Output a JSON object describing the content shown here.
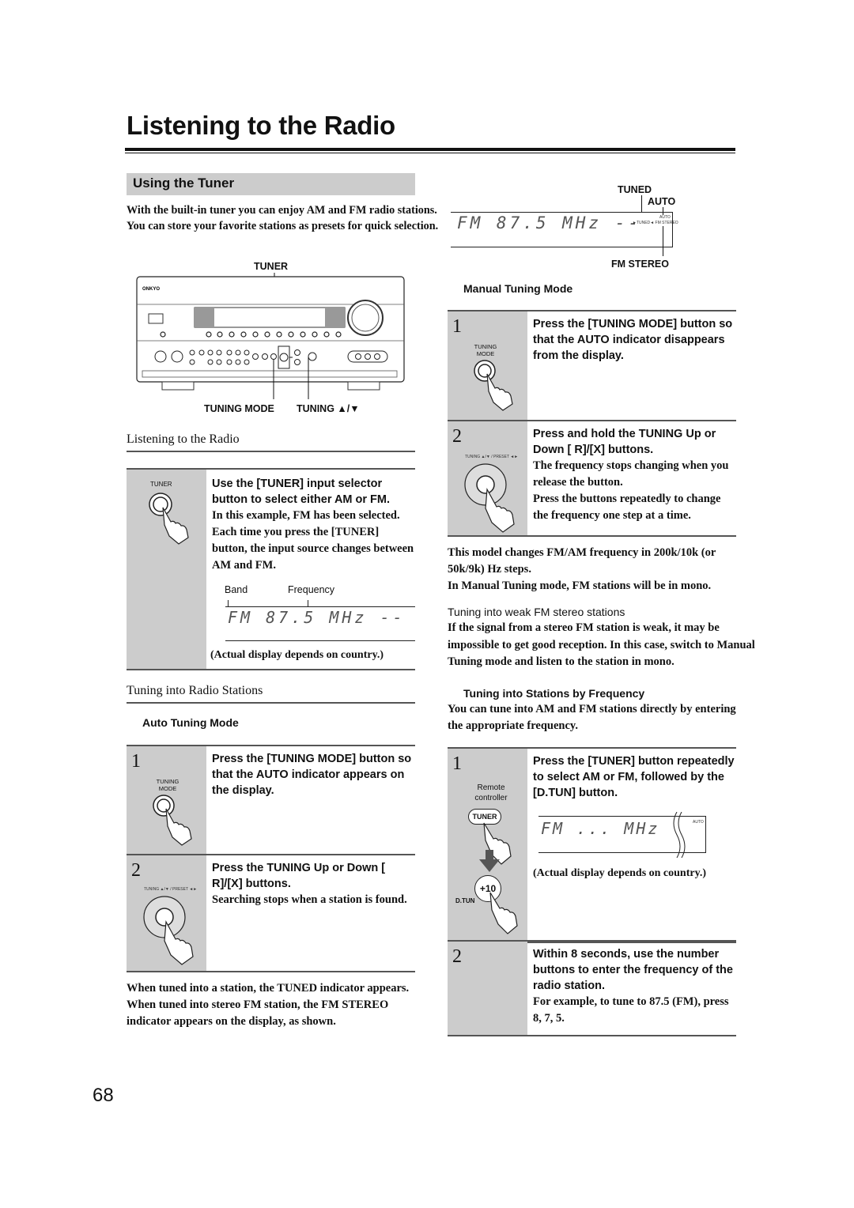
{
  "page": {
    "title": "Listening to the Radio",
    "page_number": "68"
  },
  "section": {
    "title": "Using the Tuner",
    "intro": "With the built-in tuner you can enjoy AM and FM radio stations. You can store your favorite stations as presets for quick selection."
  },
  "receiver_diagram": {
    "brand": "ONKYO",
    "callout_tuner": "TUNER",
    "callout_tuning_mode": "TUNING MODE",
    "callout_tuning": "TUNING ▲/▼"
  },
  "listening": {
    "heading": "Listening to the Radio",
    "step": {
      "icon_label": "TUNER",
      "main": "Use the [TUNER] input selector button to select either AM or FM.",
      "sub1": "In this example, FM has been selected.",
      "sub2": "Each time you press the [TUNER] button, the input source changes between AM and FM.",
      "band_label": "Band",
      "frequency_label": "Frequency",
      "display": "FM  87.5  MHz  --",
      "note": "(Actual display depends on country.)"
    }
  },
  "tuning_stations": {
    "heading": "Tuning into Radio Stations",
    "auto_mode": {
      "heading": "Auto Tuning Mode",
      "steps": [
        {
          "number": "1",
          "icon_label": "TUNING MODE",
          "main": "Press the [TUNING MODE] button so that the AUTO indicator appears on the display."
        },
        {
          "number": "2",
          "icon_label": "TUNING ▲/▼ / PRESET ◄►",
          "main": "Press the TUNING Up or Down [ R]/[X] buttons.",
          "sub": "Searching stops when a station is found."
        }
      ]
    },
    "tuned_note": "When tuned into a station, the TUNED indicator appears. When tuned into stereo FM station, the FM STEREO indicator appears on the display, as shown."
  },
  "indicator_display": {
    "callout_tuned": "TUNED",
    "callout_auto": "AUTO",
    "callout_fm_stereo": "FM STEREO",
    "display": "FM  87.5  MHz  --",
    "small_auto": "AUTO",
    "small_line": "►TUNED◄ FM STEREO"
  },
  "manual_mode": {
    "heading": "Manual Tuning Mode",
    "steps": [
      {
        "number": "1",
        "icon_label": "TUNING MODE",
        "main": "Press the [TUNING MODE] button so that the AUTO indicator disappears from the display."
      },
      {
        "number": "2",
        "icon_label": "TUNING ▲/▼ / PRESET ◄►",
        "main": "Press and hold the TUNING Up or Down [ R]/[X] buttons.",
        "sub1": "The frequency stops changing when you release the button.",
        "sub2": "Press the buttons repeatedly to change the frequency one step at a time."
      }
    ],
    "note1": "This model changes FM/AM frequency in 200k/10k (or 50k/9k) Hz steps.",
    "note2": "In Manual Tuning mode, FM stations will be in mono."
  },
  "weak_stereo": {
    "heading": "Tuning into weak FM stereo stations",
    "text": "If the signal from a stereo FM station is weak, it may be impossible to get good reception. In this case, switch to Manual Tuning mode and listen to the station in mono."
  },
  "by_frequency": {
    "heading": "Tuning into Stations by Frequency",
    "intro": "You can tune into AM and FM stations directly by entering the appropriate frequency.",
    "steps": [
      {
        "number": "1",
        "remote_label": "Remote controller",
        "tuner_button": "TUNER",
        "dtun_button": "+10",
        "dtun_label": "D.TUN",
        "main": "Press the [TUNER] button repeatedly to select AM or FM, followed by the [D.TUN] button.",
        "display": "FM ...  MHz",
        "display_auto": "AUTO",
        "note": "(Actual display depends on country.)"
      },
      {
        "number": "2",
        "main": "Within 8 seconds, use the number buttons to enter the frequency of the radio station.",
        "sub": "For example, to tune to 87.5 (FM), press 8, 7, 5."
      }
    ]
  }
}
